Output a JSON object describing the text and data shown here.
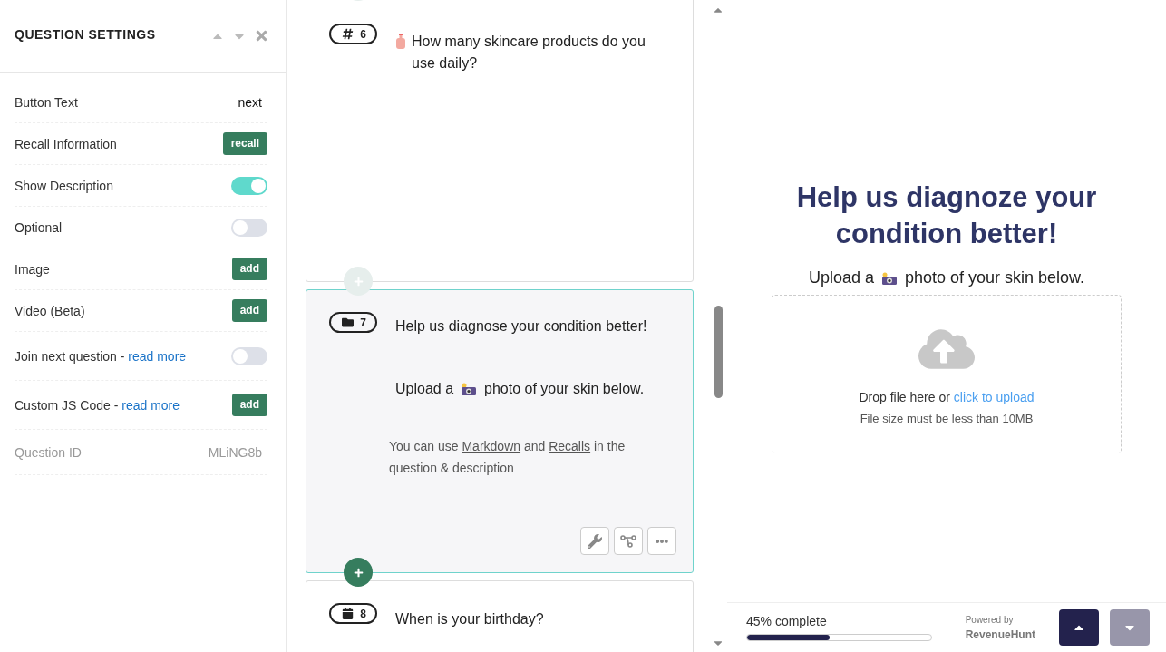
{
  "settings": {
    "title": "QUESTION SETTINGS",
    "rows": [
      {
        "kind": "value",
        "label": "Button Text",
        "value": "next"
      },
      {
        "kind": "button",
        "label": "Recall Information",
        "button": "recall"
      },
      {
        "kind": "toggle",
        "label": "Show Description",
        "on": true
      },
      {
        "kind": "toggle",
        "label": "Optional",
        "on": false
      },
      {
        "kind": "button",
        "label": "Image",
        "button": "add"
      },
      {
        "kind": "button",
        "label": "Video (Beta)",
        "button": "add"
      },
      {
        "kind": "toggle",
        "label": "Join next question - ",
        "link": "read more",
        "on": false
      },
      {
        "kind": "button",
        "label": "Custom JS Code - ",
        "link": "read more",
        "button": "add"
      },
      {
        "kind": "id",
        "label": "Question ID",
        "value": "MLiNG8b"
      }
    ]
  },
  "questions": [
    {
      "kind": "number",
      "number": "6",
      "selected": false,
      "title_icon": true,
      "title": "How many skincare products do you use daily?"
    },
    {
      "kind": "folder",
      "number": "7",
      "selected": true,
      "title": "Help us diagnose your condition better!",
      "upload": {
        "before": "Upload a",
        "after": "photo of your skin below."
      },
      "hint": [
        {
          "kind": "text",
          "text": "You can use "
        },
        {
          "kind": "link",
          "text": "Markdown"
        },
        {
          "kind": "text",
          "text": " and "
        },
        {
          "kind": "link",
          "text": "Recalls"
        },
        {
          "kind": "text",
          "text": " in the question & description"
        }
      ]
    },
    {
      "kind": "date",
      "number": "8",
      "selected": false,
      "title": "When is your birthday?"
    }
  ],
  "preview": {
    "title": "Help us diagnoze your condition better!",
    "upload": {
      "before": "Upload a",
      "after": "photo of your skin below."
    },
    "dropzone": {
      "text": "Drop file here or ",
      "link": "click to upload",
      "note": "File size must be less than 10MB"
    },
    "footer": {
      "progress_text": "45% complete",
      "level": 0.45,
      "powered_by": "Powered by",
      "brand": "RevenueHunt",
      "prev_disabled": false,
      "next_disabled": true
    }
  }
}
